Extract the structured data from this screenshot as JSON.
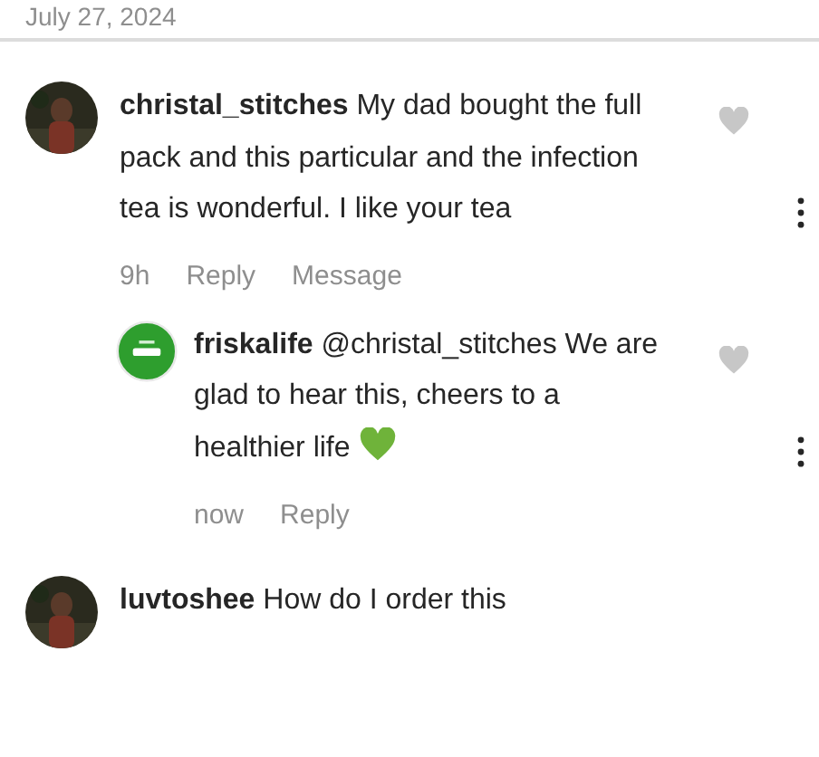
{
  "date": "July 27, 2024",
  "comments": [
    {
      "username": "christal_stitches",
      "text": "My dad bought the full pack and this particular and the infection tea is wonderful. I like your tea",
      "emoji": false,
      "liked": false,
      "meta": {
        "time": "9h",
        "actions": [
          "Reply",
          "Message"
        ]
      },
      "replies": [
        {
          "username": "friskalife",
          "text": "@christal_stitches We are glad to hear this, cheers to a healthier life",
          "emoji": true,
          "liked": false,
          "meta": {
            "time": "now",
            "actions": [
              "Reply"
            ]
          }
        }
      ]
    },
    {
      "username": "luvtoshee",
      "text": "How do I order this",
      "emoji": false
    }
  ]
}
